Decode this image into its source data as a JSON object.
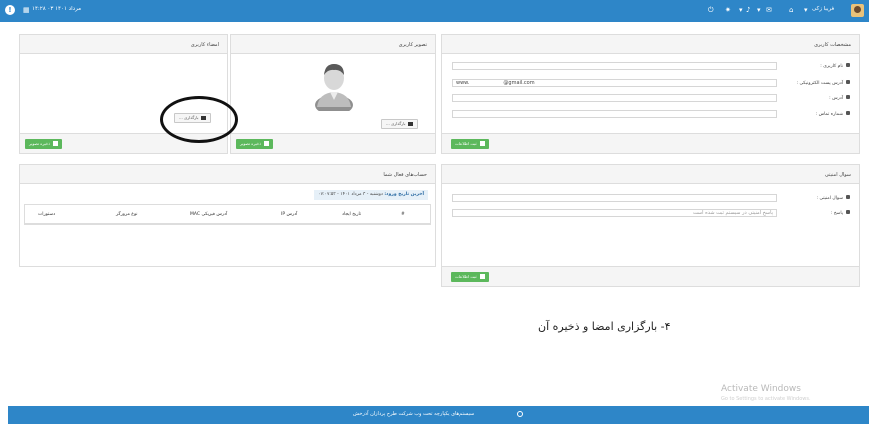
{
  "topbar": {
    "user_name": "فریبا زکی",
    "datetime": "۱۴:۲۸ ۰۳ مرداد ۱۴۰۱"
  },
  "user_info": {
    "title": "مشخصات کاربری",
    "username_label": "نام کاربری :",
    "email_label": "آدرس پست الکترونیکی :",
    "email_value_prefix": "www.",
    "email_value_domain": "@gmail.com",
    "address_label": "آدرس :",
    "phone_label": "شماره تماس :",
    "submit_label": "ثبت اطلاعات"
  },
  "user_image": {
    "title": "تصویر کاربری",
    "upload_label": "بارگذاری ...",
    "save_label": "ذخیره تصویر"
  },
  "user_signature": {
    "title": "امضاء کاربری",
    "upload_label": "بارگذاری ...",
    "save_label": "ذخیره تصویر"
  },
  "security": {
    "title": "سوال امنیتی",
    "question_label": "سوال امنیتی :",
    "answer_label": "پاسخ :",
    "answer_placeholder": "پاسخ امنیتی در سیستم ثبت شده است",
    "submit_label": "ثبت اطلاعات"
  },
  "accounts": {
    "title": "حساب‌های فعال شما",
    "last_login_label": "آخرین تاریخ ورود:",
    "last_login_value": "دوشنبه - ۳ مرداد ۱۴۰۱ - ۰۷:۰۷:۵۳",
    "columns": [
      "#",
      "تاریخ ایجاد",
      "آدرس IP",
      "آدرس فیزیکی MAC",
      "نوع مرورگر",
      "دستورات"
    ]
  },
  "caption": "۴- بارگزاری امضا و ذخیره آن",
  "watermark": {
    "title": "Activate Windows",
    "subtitle": "Go to Settings to activate Windows."
  },
  "footer": {
    "text": "سیستم‌های یکپارچه تحت وب شرکت طرح پردازان آذرخش"
  }
}
